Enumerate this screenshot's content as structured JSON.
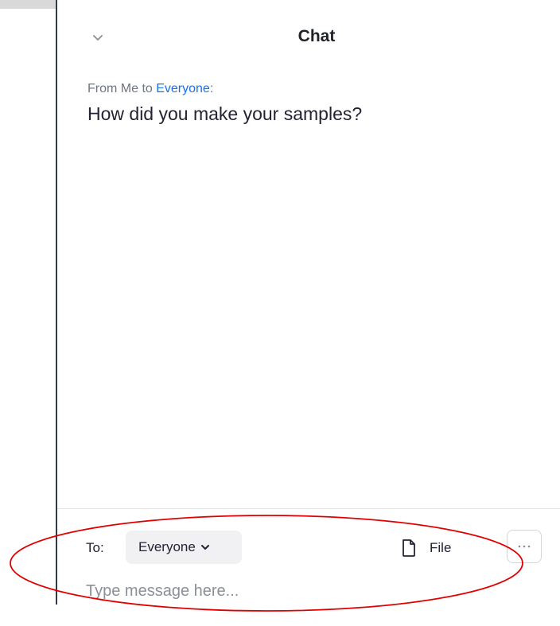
{
  "header": {
    "title": "Chat"
  },
  "messages": [
    {
      "from_prefix": "From Me to ",
      "recipient": "Everyone",
      "suffix": ":",
      "text": "How did you make your samples?"
    }
  ],
  "composer": {
    "to_label": "To:",
    "recipient_selected": "Everyone",
    "file_label": "File",
    "more_label": "···",
    "placeholder": "Type message here..."
  },
  "colors": {
    "recipient_link": "#1a6fe3",
    "annotation_ellipse": "#e00000",
    "panel_border": "#2f3a4c"
  },
  "icons": {
    "collapse": "chevron-down-icon",
    "recipient_dropdown": "chevron-down-icon",
    "file": "file-icon",
    "more": "more-dots-icon"
  }
}
